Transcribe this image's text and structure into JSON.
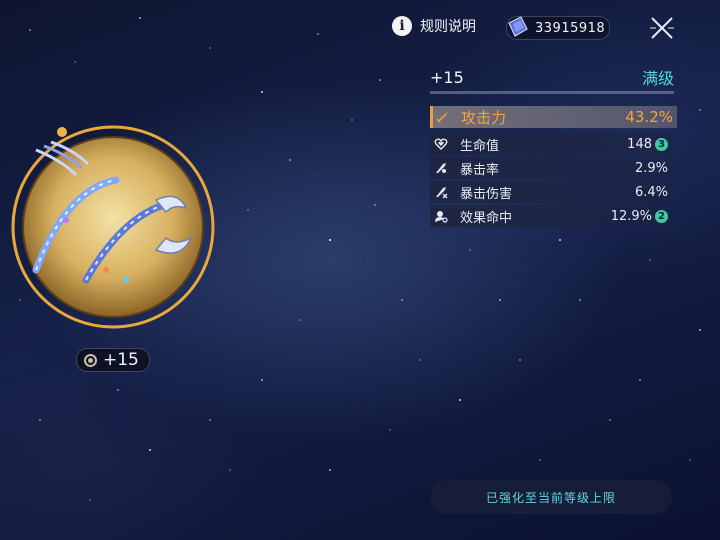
{
  "header": {
    "rules_label": "规则说明",
    "currency_amount": "33915918"
  },
  "item": {
    "level_badge": "+15"
  },
  "panel": {
    "current_level": "+15",
    "max_label": "满级",
    "main_stat": {
      "name": "攻击力",
      "value": "43.2%"
    },
    "sub_stats": [
      {
        "name": "生命值",
        "value": "148",
        "upgrades": "3"
      },
      {
        "name": "暴击率",
        "value": "2.9%"
      },
      {
        "name": "暴击伤害",
        "value": "6.4%"
      },
      {
        "name": "效果命中",
        "value": "12.9%",
        "upgrades": "2"
      }
    ]
  },
  "status_text": "已强化至当前等级上限",
  "colors": {
    "accent_teal": "#4fd6d9",
    "main_stat_orange": "#f5a340",
    "upgrade_badge": "#3fc9a7",
    "item_frame_gold": "#e8a93a"
  },
  "icons": {
    "info": "info-icon",
    "currency": "crystal-icon",
    "close": "close-icon",
    "attack": "sword-icon",
    "hp": "heart-icon",
    "crit_rate": "crit-rate-icon",
    "crit_damage": "crit-damage-icon",
    "effect_hit": "effect-hit-icon"
  }
}
